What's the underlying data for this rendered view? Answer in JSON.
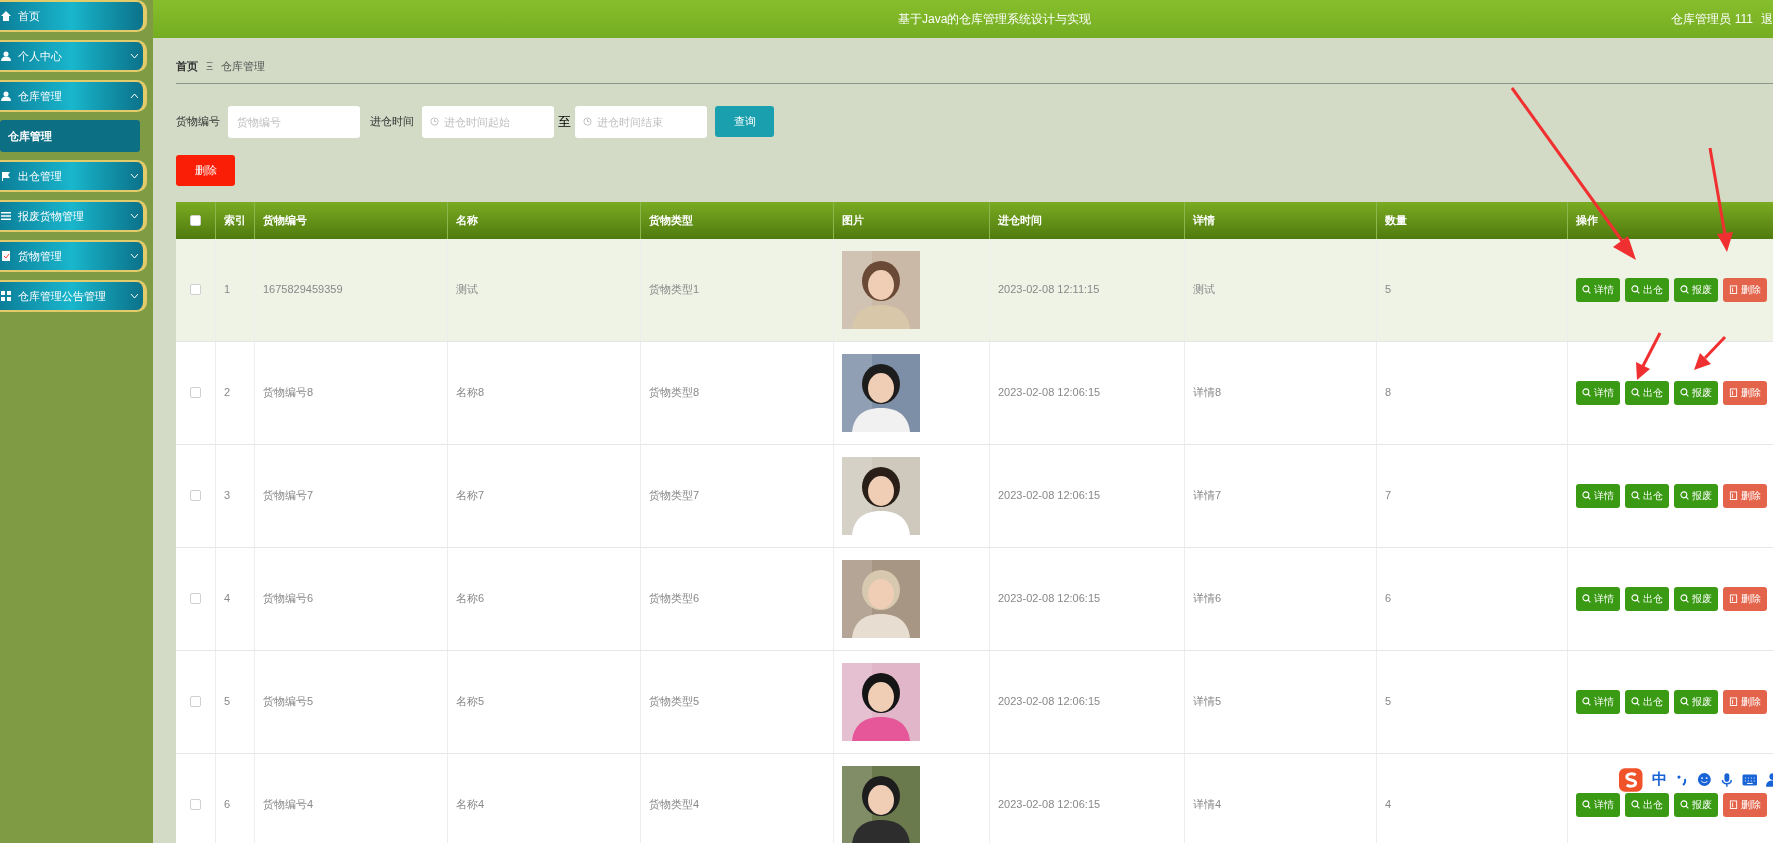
{
  "sidebar": {
    "items": [
      {
        "label": "首页"
      },
      {
        "label": "个人中心",
        "expanded": false
      },
      {
        "label": "仓库管理",
        "expanded": true,
        "children": [
          {
            "label": "仓库管理",
            "selected": true
          }
        ]
      },
      {
        "label": "出仓管理",
        "expanded": false
      },
      {
        "label": "报废货物管理",
        "expanded": false
      },
      {
        "label": "货物管理",
        "expanded": false
      },
      {
        "label": "仓库管理公告管理",
        "expanded": false
      }
    ]
  },
  "header": {
    "title": "基于Java的仓库管理系统设计与实现",
    "user": "仓库管理员 111",
    "logout": "退"
  },
  "breadcrumb": {
    "items": [
      "首页",
      "仓库管理"
    ],
    "separator": "Ξ"
  },
  "search": {
    "code_label": "货物编号",
    "code_placeholder": "货物编号",
    "time_label": "进仓时间",
    "start_placeholder": "进仓时间起始",
    "to": "至",
    "end_placeholder": "进仓时间结束",
    "query_button": "查询"
  },
  "delete_button": "删除",
  "table": {
    "columns": [
      "索引",
      "货物编号",
      "名称",
      "货物类型",
      "图片",
      "进仓时间",
      "详情",
      "数量",
      "操作"
    ],
    "header_checked": false,
    "rows": [
      {
        "checked": false,
        "highlighted": true,
        "cells": [
          "1",
          "1675829459359",
          "测试",
          "货物类型1"
        ],
        "time": "2023-02-08 12:11:15",
        "detail": "测试",
        "qty": "5",
        "actions": [
          {
            "label": "详情",
            "kind": "search"
          },
          {
            "label": "出仓",
            "kind": "search"
          },
          {
            "label": "报废",
            "kind": "search"
          },
          {
            "label": "删除",
            "kind": "delete"
          }
        ]
      },
      {
        "checked": false,
        "highlighted": false,
        "cells": [
          "2",
          "货物编号8",
          "名称8",
          "货物类型8"
        ],
        "time": "2023-02-08 12:06:15",
        "detail": "详情8",
        "qty": "8",
        "actions": [
          {
            "label": "详情",
            "kind": "search"
          },
          {
            "label": "出仓",
            "kind": "search"
          },
          {
            "label": "报废",
            "kind": "search"
          },
          {
            "label": "删除",
            "kind": "delete"
          }
        ]
      },
      {
        "checked": false,
        "highlighted": false,
        "cells": [
          "3",
          "货物编号7",
          "名称7",
          "货物类型7"
        ],
        "time": "2023-02-08 12:06:15",
        "detail": "详情7",
        "qty": "7",
        "actions": [
          {
            "label": "详情",
            "kind": "search"
          },
          {
            "label": "出仓",
            "kind": "search"
          },
          {
            "label": "报废",
            "kind": "search"
          },
          {
            "label": "删除",
            "kind": "delete"
          }
        ]
      },
      {
        "checked": false,
        "highlighted": false,
        "cells": [
          "4",
          "货物编号6",
          "名称6",
          "货物类型6"
        ],
        "time": "2023-02-08 12:06:15",
        "detail": "详情6",
        "qty": "6",
        "actions": [
          {
            "label": "详情",
            "kind": "search"
          },
          {
            "label": "出仓",
            "kind": "search"
          },
          {
            "label": "报废",
            "kind": "search"
          },
          {
            "label": "删除",
            "kind": "delete"
          }
        ]
      },
      {
        "checked": false,
        "highlighted": false,
        "cells": [
          "5",
          "货物编号5",
          "名称5",
          "货物类型5"
        ],
        "time": "2023-02-08 12:06:15",
        "detail": "详情5",
        "qty": "5",
        "actions": [
          {
            "label": "详情",
            "kind": "search"
          },
          {
            "label": "出仓",
            "kind": "search"
          },
          {
            "label": "报废",
            "kind": "search"
          },
          {
            "label": "删除",
            "kind": "delete"
          }
        ]
      },
      {
        "checked": false,
        "highlighted": false,
        "cells": [
          "6",
          "货物编号4",
          "名称4",
          "货物类型4"
        ],
        "time": "2023-02-08 12:06:15",
        "detail": "详情4",
        "qty": "4",
        "actions": [
          {
            "label": "详情",
            "kind": "search"
          },
          {
            "label": "出仓",
            "kind": "search"
          },
          {
            "label": "报废",
            "kind": "search"
          },
          {
            "label": "删除",
            "kind": "delete"
          }
        ]
      }
    ]
  },
  "ime_toolbar": {
    "mode": "中"
  }
}
